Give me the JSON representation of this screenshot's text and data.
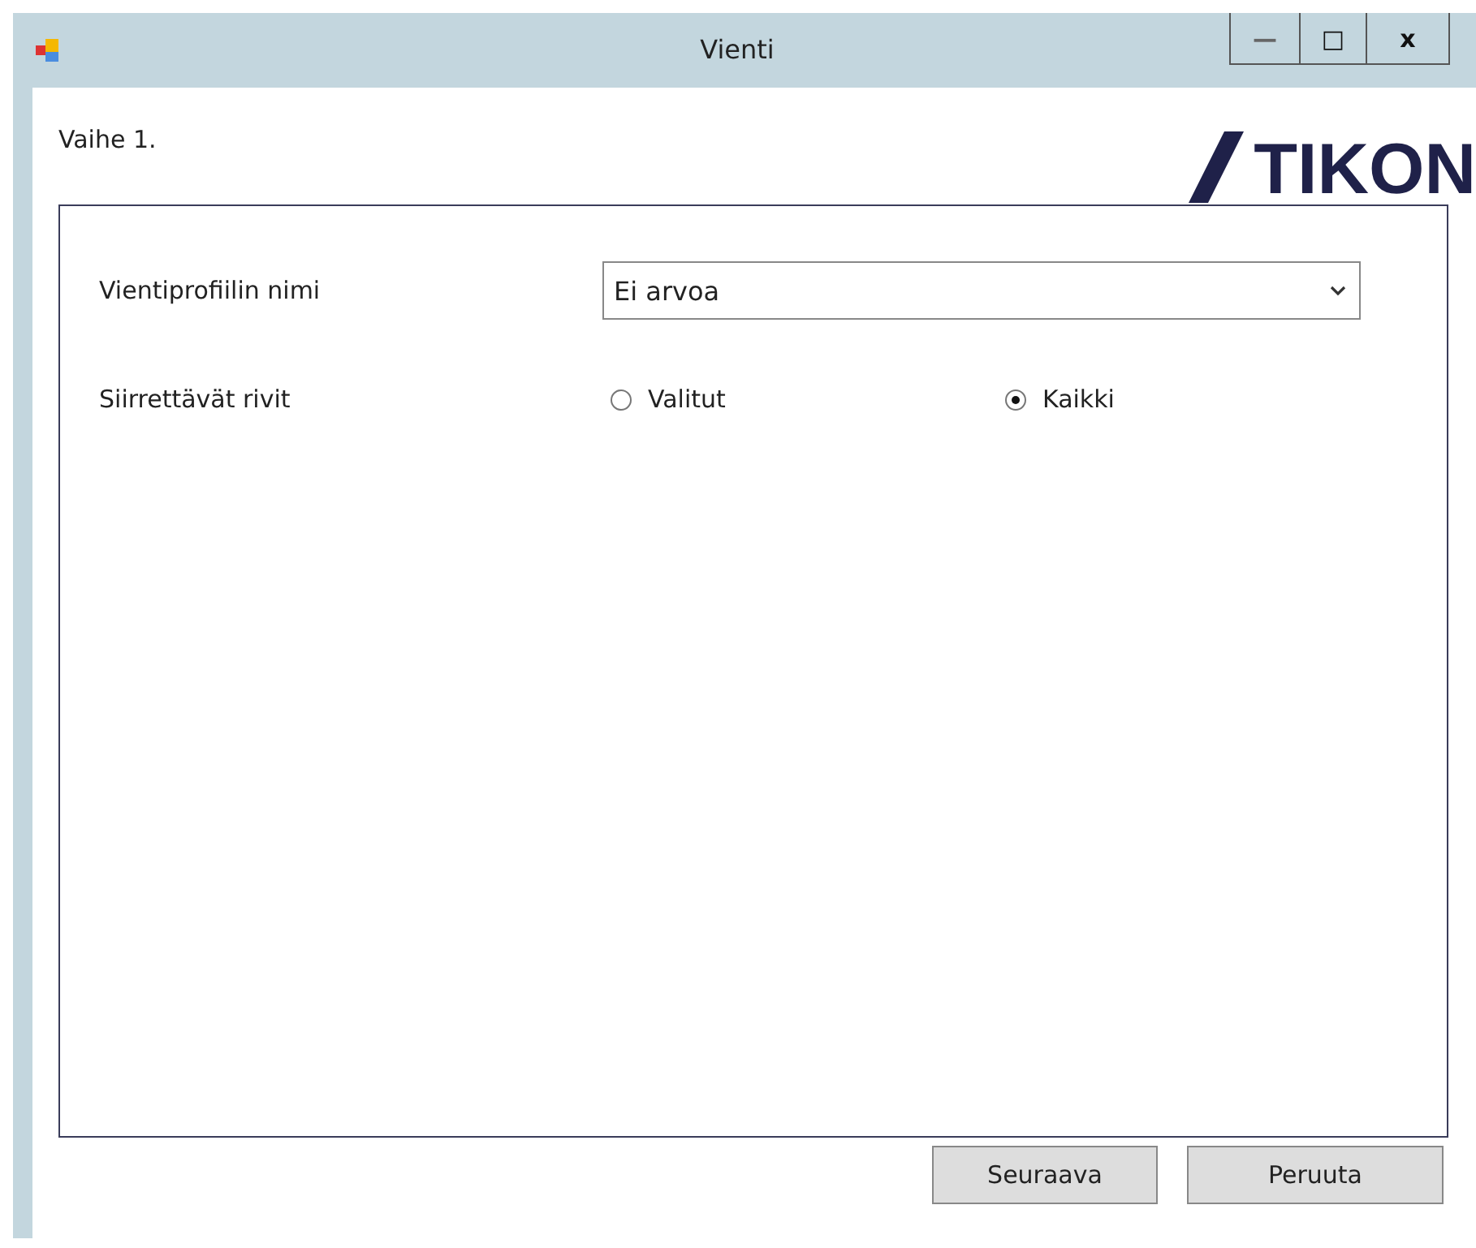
{
  "window": {
    "title": "Vienti",
    "controls": [
      "—",
      "□",
      "x"
    ]
  },
  "step": "Vaihe 1.",
  "logo": "TIKON",
  "profile": {
    "label": "Vientiprofiilin nimi",
    "value": "Ei arvoa"
  },
  "rows": {
    "label": "Siirrettävät rivit",
    "options": [
      {
        "label": "Valitut",
        "selected": false
      },
      {
        "label": "Kaikki",
        "selected": true
      }
    ]
  },
  "buttons": [
    "Seuraava",
    "Peruuta"
  ]
}
